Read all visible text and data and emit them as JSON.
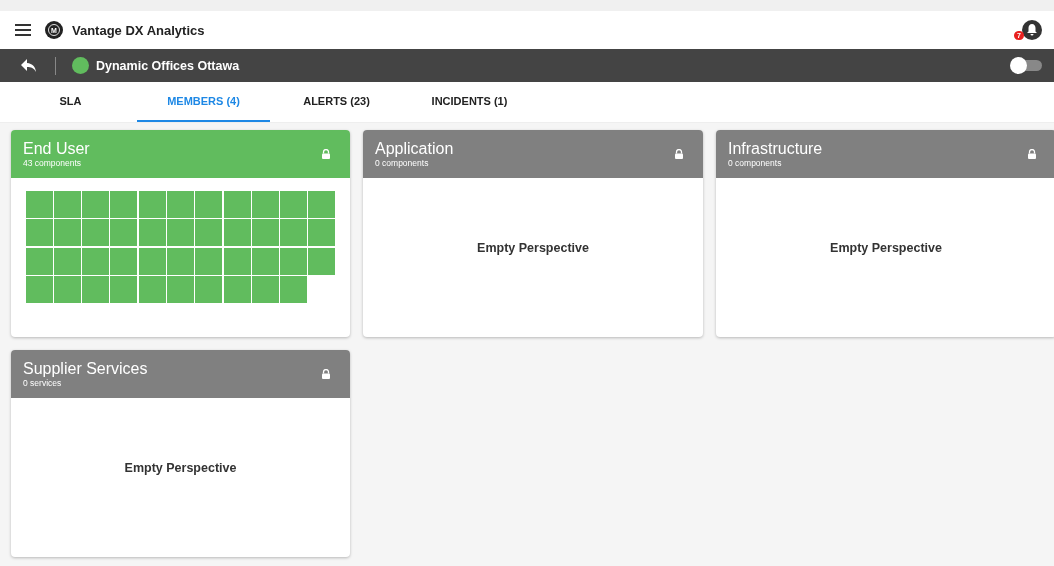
{
  "app": {
    "title": "Vantage DX Analytics",
    "logo_letter": "M",
    "notifications": "7"
  },
  "context_bar": {
    "name": "Dynamic Offices Ottawa",
    "color": "#61bc5e",
    "toggle_on": false
  },
  "tabs": [
    {
      "label": "SLA",
      "selected": false
    },
    {
      "label": "MEMBERS (4)",
      "selected": true
    },
    {
      "label": "ALERTS (23)",
      "selected": false
    },
    {
      "label": "INCIDENTS (1)",
      "selected": false
    }
  ],
  "cards": [
    {
      "title": "End User",
      "subtitle": "43 components",
      "color": "#61bc5e",
      "locked": true,
      "tiles": [
        {
          "color": "#61bc5e"
        },
        {
          "color": "#61bc5e"
        },
        {
          "color": "#61bc5e"
        },
        {
          "color": "#61bc5e"
        },
        {
          "color": "#61bc5e"
        },
        {
          "color": "#61bc5e"
        },
        {
          "color": "#61bc5e"
        },
        {
          "color": "#61bc5e"
        },
        {
          "color": "#61bc5e"
        },
        {
          "color": "#61bc5e"
        },
        {
          "color": "#61bc5e"
        },
        {
          "color": "#61bc5e"
        },
        {
          "color": "#61bc5e"
        },
        {
          "color": "#61bc5e"
        },
        {
          "color": "#61bc5e"
        },
        {
          "color": "#61bc5e"
        },
        {
          "color": "#61bc5e"
        },
        {
          "color": "#61bc5e"
        },
        {
          "color": "#61bc5e"
        },
        {
          "color": "#61bc5e"
        },
        {
          "color": "#61bc5e"
        },
        {
          "color": "#61bc5e"
        },
        {
          "color": "#61bc5e"
        },
        {
          "color": "#61bc5e"
        },
        {
          "color": "#61bc5e"
        },
        {
          "color": "#61bc5e"
        },
        {
          "color": "#61bc5e"
        },
        {
          "color": "#61bc5e"
        },
        {
          "color": "#61bc5e"
        },
        {
          "color": "#61bc5e"
        },
        {
          "color": "#61bc5e"
        },
        {
          "color": "#61bc5e"
        },
        {
          "color": "#61bc5e"
        },
        {
          "color": "#61bc5e"
        },
        {
          "color": "#61bc5e"
        },
        {
          "color": "#61bc5e"
        },
        {
          "color": "#61bc5e"
        },
        {
          "color": "#61bc5e"
        },
        {
          "color": "#61bc5e"
        },
        {
          "color": "#61bc5e"
        },
        {
          "color": "#61bc5e"
        },
        {
          "color": "#61bc5e"
        },
        {
          "color": "#61bc5e"
        }
      ]
    },
    {
      "title": "Application",
      "subtitle": "0 components",
      "color": "#808080",
      "locked": true,
      "empty_text": "Empty Perspective"
    },
    {
      "title": "Infrastructure",
      "subtitle": "0 components",
      "color": "#808080",
      "locked": true,
      "empty_text": "Empty Perspective"
    },
    {
      "title": "Supplier Services",
      "subtitle": "0 services",
      "color": "#808080",
      "locked": true,
      "empty_text": "Empty Perspective"
    }
  ]
}
